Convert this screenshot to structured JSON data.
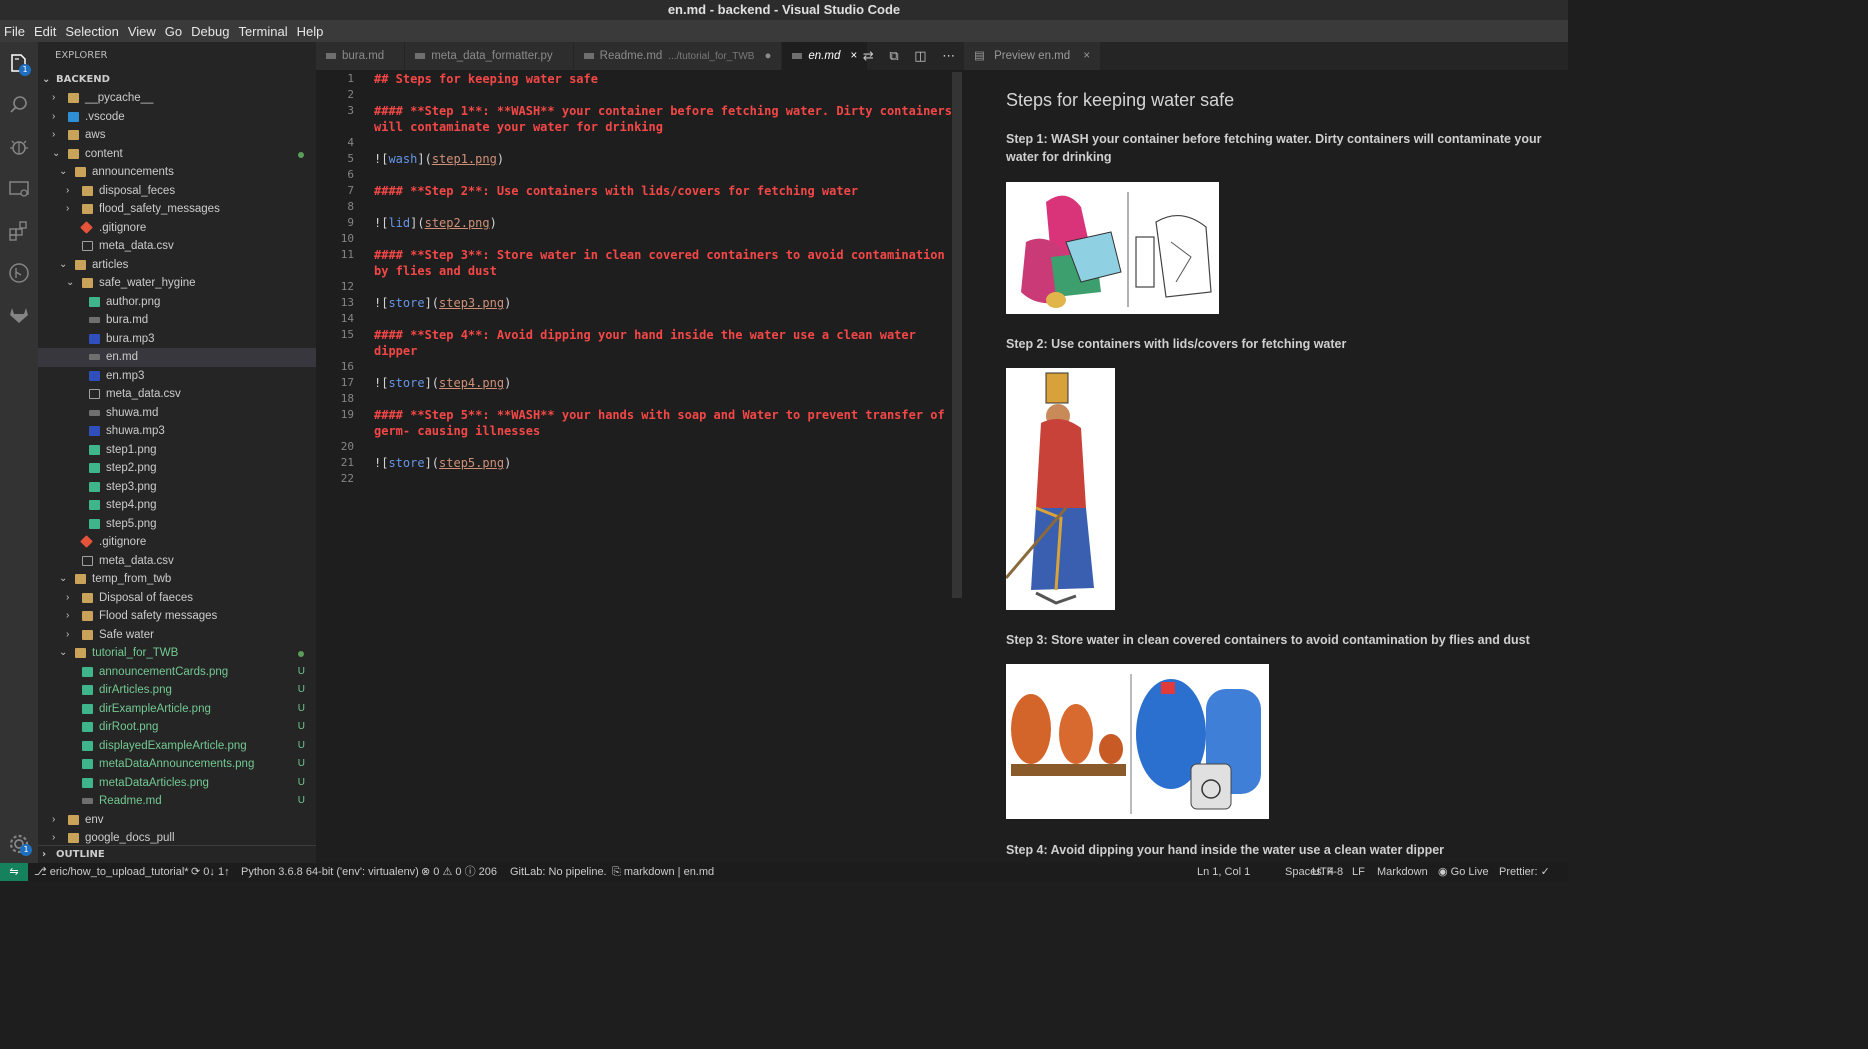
{
  "window": {
    "title": "en.md - backend - Visual Studio Code"
  },
  "menu": [
    "File",
    "Edit",
    "Selection",
    "View",
    "Go",
    "Debug",
    "Terminal",
    "Help"
  ],
  "activity": {
    "explorer_badge": "1",
    "settings_badge": "1"
  },
  "sidebar": {
    "title": "EXPLORER",
    "root": "BACKEND",
    "outline": "OUTLINE",
    "tree": [
      {
        "label": "__pycache__",
        "depth": 1,
        "kind": "folder",
        "open": false
      },
      {
        "label": ".vscode",
        "depth": 1,
        "kind": "vscode",
        "open": false
      },
      {
        "label": "aws",
        "depth": 1,
        "kind": "folder",
        "open": false
      },
      {
        "label": "content",
        "depth": 1,
        "kind": "folder",
        "open": true,
        "dot": true
      },
      {
        "label": "announcements",
        "depth": 2,
        "kind": "folder",
        "open": true
      },
      {
        "label": "disposal_feces",
        "depth": 3,
        "kind": "folder",
        "open": false
      },
      {
        "label": "flood_safety_messages",
        "depth": 3,
        "kind": "folder",
        "open": false
      },
      {
        "label": ".gitignore",
        "depth": 3,
        "kind": "git"
      },
      {
        "label": "meta_data.csv",
        "depth": 3,
        "kind": "csv"
      },
      {
        "label": "articles",
        "depth": 2,
        "kind": "folder",
        "open": true
      },
      {
        "label": "safe_water_hygine",
        "depth": 3,
        "kind": "folder",
        "open": true
      },
      {
        "label": "author.png",
        "depth": 4,
        "kind": "png"
      },
      {
        "label": "bura.md",
        "depth": 4,
        "kind": "md"
      },
      {
        "label": "bura.mp3",
        "depth": 4,
        "kind": "mp3"
      },
      {
        "label": "en.md",
        "depth": 4,
        "kind": "md",
        "selected": true
      },
      {
        "label": "en.mp3",
        "depth": 4,
        "kind": "mp3"
      },
      {
        "label": "meta_data.csv",
        "depth": 4,
        "kind": "csv"
      },
      {
        "label": "shuwa.md",
        "depth": 4,
        "kind": "md"
      },
      {
        "label": "shuwa.mp3",
        "depth": 4,
        "kind": "mp3"
      },
      {
        "label": "step1.png",
        "depth": 4,
        "kind": "png"
      },
      {
        "label": "step2.png",
        "depth": 4,
        "kind": "png"
      },
      {
        "label": "step3.png",
        "depth": 4,
        "kind": "png"
      },
      {
        "label": "step4.png",
        "depth": 4,
        "kind": "png"
      },
      {
        "label": "step5.png",
        "depth": 4,
        "kind": "png"
      },
      {
        "label": ".gitignore",
        "depth": 3,
        "kind": "git"
      },
      {
        "label": "meta_data.csv",
        "depth": 3,
        "kind": "csv"
      },
      {
        "label": "temp_from_twb",
        "depth": 2,
        "kind": "folder",
        "open": true
      },
      {
        "label": "Disposal of faeces",
        "depth": 3,
        "kind": "folder",
        "open": false
      },
      {
        "label": "Flood safety messages",
        "depth": 3,
        "kind": "folder",
        "open": false
      },
      {
        "label": "Safe water",
        "depth": 3,
        "kind": "folder",
        "open": false
      },
      {
        "label": "tutorial_for_TWB",
        "depth": 2,
        "kind": "folder",
        "open": true,
        "green": true,
        "dot": true
      },
      {
        "label": "announcementCards.png",
        "depth": 3,
        "kind": "png",
        "green": true,
        "status": "U"
      },
      {
        "label": "dirArticles.png",
        "depth": 3,
        "kind": "png",
        "green": true,
        "status": "U"
      },
      {
        "label": "dirExampleArticle.png",
        "depth": 3,
        "kind": "png",
        "green": true,
        "status": "U"
      },
      {
        "label": "dirRoot.png",
        "depth": 3,
        "kind": "png",
        "green": true,
        "status": "U"
      },
      {
        "label": "displayedExampleArticle.png",
        "depth": 3,
        "kind": "png",
        "green": true,
        "status": "U"
      },
      {
        "label": "metaDataAnnouncements.png",
        "depth": 3,
        "kind": "png",
        "green": true,
        "status": "U"
      },
      {
        "label": "metaDataArticles.png",
        "depth": 3,
        "kind": "png",
        "green": true,
        "status": "U"
      },
      {
        "label": "Readme.md",
        "depth": 3,
        "kind": "md",
        "green": true,
        "status": "U"
      },
      {
        "label": "env",
        "depth": 1,
        "kind": "folder",
        "open": false
      },
      {
        "label": "google_docs_pull",
        "depth": 1,
        "kind": "folder",
        "open": false
      }
    ]
  },
  "tabs": [
    {
      "label": "bura.md",
      "sub": "",
      "active": false,
      "modified": false
    },
    {
      "label": "meta_data_formatter.py",
      "sub": "",
      "active": false,
      "modified": false
    },
    {
      "label": "Readme.md",
      "sub": ".../tutorial_for_TWB",
      "active": false,
      "modified": true
    },
    {
      "label": "en.md",
      "sub": "",
      "active": true,
      "modified": false
    }
  ],
  "editor_lines": [
    {
      "n": "1",
      "text": "## Steps for keeping water safe"
    },
    {
      "n": "2",
      "text": ""
    },
    {
      "n": "3",
      "text": "#### **Step 1**: **WASH** your container before fetching water. Dirty containers"
    },
    {
      "n": "",
      "text": "will contaminate your water for drinking"
    },
    {
      "n": "4",
      "text": ""
    },
    {
      "n": "5",
      "alt": "wash",
      "url": "step1.png"
    },
    {
      "n": "6",
      "text": ""
    },
    {
      "n": "7",
      "text": "#### **Step 2**: Use containers with lids/covers for fetching water"
    },
    {
      "n": "8",
      "text": ""
    },
    {
      "n": "9",
      "alt": "lid",
      "url": "step2.png"
    },
    {
      "n": "10",
      "text": ""
    },
    {
      "n": "11",
      "text": "#### **Step 3**: Store water in clean covered containers to avoid contamination"
    },
    {
      "n": "",
      "text": "by flies and dust"
    },
    {
      "n": "12",
      "text": ""
    },
    {
      "n": "13",
      "alt": "store",
      "url": "step3.png"
    },
    {
      "n": "14",
      "text": ""
    },
    {
      "n": "15",
      "text": "#### **Step 4**: Avoid dipping your hand inside the water use a clean water"
    },
    {
      "n": "",
      "text": "dipper"
    },
    {
      "n": "16",
      "text": ""
    },
    {
      "n": "17",
      "alt": "store",
      "url": "step4.png"
    },
    {
      "n": "18",
      "text": ""
    },
    {
      "n": "19",
      "text": "#### **Step 5**: **WASH** your hands with soap and Water to prevent transfer of"
    },
    {
      "n": "",
      "text": "germ- causing illnesses"
    },
    {
      "n": "20",
      "text": ""
    },
    {
      "n": "21",
      "alt": "store",
      "url": "step5.png"
    },
    {
      "n": "22",
      "text": ""
    }
  ],
  "preview": {
    "tab": "Preview en.md",
    "heading": "Steps for keeping water safe",
    "step1": "Step 1: WASH your container before fetching water. Dirty containers will contaminate your water for drinking",
    "step2": "Step 2: Use containers with lids/covers for fetching water",
    "step3": "Step 3: Store water in clean covered containers to avoid contamination by flies and dust",
    "step4": "Step 4: Avoid dipping your hand inside the water use a clean water dipper"
  },
  "status": {
    "branch": "eric/how_to_upload_tutorial*",
    "sync": "0↓ 1↑",
    "python": "Python 3.6.8 64-bit ('env': virtualenv)",
    "problems": "0",
    "warnings": "0",
    "info": "206",
    "gitlab": "GitLab: No pipeline.",
    "lang_mode": "markdown | en.md",
    "position": "Ln 1, Col 1",
    "spaces": "Spaces: 4",
    "encoding": "UTF-8",
    "eol": "LF",
    "language": "Markdown",
    "golive": "Go Live",
    "prettier": "Prettier: ✓"
  }
}
